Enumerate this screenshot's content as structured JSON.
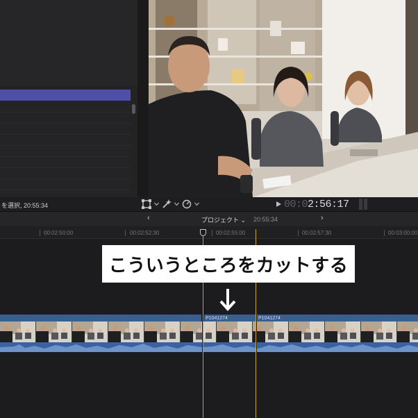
{
  "status": {
    "selection_info": "を選択, 20:55:34",
    "timecode_dim": "00:0",
    "timecode_bright": "2:56:17"
  },
  "timeline_header": {
    "prev_label": "‹",
    "next_label": "›",
    "project_title": "プロジェクト ⌄",
    "project_duration": "20:55:34"
  },
  "ruler": {
    "labels": [
      "00:02:50:00",
      "00:02:52:30",
      "00:02:55:00",
      "00:02:57:30",
      "00:03:00:00"
    ]
  },
  "caption": {
    "text": "こういうところをカットする"
  },
  "clips": [
    {
      "name": "P1041274"
    },
    {
      "name": "P1041274"
    }
  ],
  "colors": {
    "accent_selection": "#4f4fa8",
    "clip_blue": "#3a5f8e",
    "skimmer_yellow": "#c9a92a"
  },
  "icons": [
    "transform-icon",
    "magic-wand-icon",
    "speed-icon",
    "play-icon",
    "down-arrow-icon"
  ]
}
